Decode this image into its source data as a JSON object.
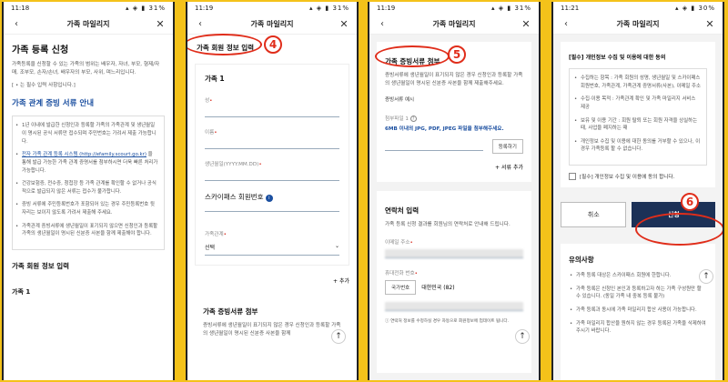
{
  "phones": [
    {
      "time": "11:18",
      "battery": "31%"
    },
    {
      "time": "11:19",
      "battery": "31%"
    },
    {
      "time": "11:19",
      "battery": "31%"
    },
    {
      "time": "11:21",
      "battery": "30%"
    }
  ],
  "nav_title": "가족 마일리지",
  "icons": {
    "back": "chevron-left-icon",
    "close": "close-icon",
    "info": "info-icon",
    "help": "help-icon",
    "up": "arrow-up-icon",
    "plus": "plus-icon",
    "down": "chevron-down-icon"
  },
  "s1": {
    "title": "가족 등록 신청",
    "desc": "가족등록을 신청할 수 있는 가족의 범위는 배우자, 자녀, 부모, 형제/자매, 조부모, 손자/손녀, 배우자의 부모, 사위, 며느리입니다.",
    "req": "[ • 는 필수 입력 사항입니다.]",
    "proof_title": "가족 관계 증빙 서류 안내",
    "b1": "1년 이내에 발급한 신청인과 등록할 가족의 가족관계 및 생년월일이 명시된 공식 서류만 접수되며 주민번호는 가려서 제출 가능합니다.",
    "b2_link": "전자 가족 관계 등록 시스템 (http://efamily.scourt.go.kr)",
    "b2_rest": "을 통해 발급 가능한 가족 관계 증명서를 첨부하시면 더욱 빠른 처리가 가능합니다.",
    "b3": "건강보험증, 전수증, 청첩장 등 가족 관계를 확인할 수 없거나 공식적으로 발급되지 않은 서류는 접수가 불가합니다.",
    "b4": "증빙 서류에 주민등록번호가 포함되어 있는 경우 주민등록번호 뒷자리는 보이지 않도록 가려서 제출해 주세요.",
    "b5": "가족관계 증빙서류에 생년월일이 표기되지 않으면 신청인과 등록할 가족의 생년월일이 명시된 신분증 사본을 함께 제출해야 합니다.",
    "input_title": "가족 회원 정보 입력",
    "fam1": "가족 1",
    "dot": "•"
  },
  "s2": {
    "header": "가족 회원 정보 입력",
    "fam1": "가족 1",
    "f_surname": "성",
    "f_name": "이름",
    "f_birth": "생년월일(YYYY.MM.DD)",
    "skypass": "스카이패스 회원번호",
    "relation_label": "가족관계",
    "relation_value": "선택",
    "add": "추가",
    "proof_title": "가족 증빙서류 첨부",
    "proof_desc": "증빙서류에 생년월일이 표기되지 않은 경우 신청인과 등록할 가족의 생년월일이 명시된 신분증 사본을 함께",
    "num": "4"
  },
  "s3": {
    "header": "가족 증빙서류 첨부",
    "desc": "증빙서류에 생년월일이 표기되지 않은 경우 신청인과 등록할 가족의 생년월일이 명시된 신분증 사본을 함께 제출해주세요.",
    "example": "증빙서류 예시",
    "attach_label": "첨부파일 1",
    "attach_note": "6MB 이내의 JPG, PDF, JPEG 파일을 첨부해주세요.",
    "register_btn": "등록하기",
    "add_doc": "서류 추가",
    "contact_title": "연락처 입력",
    "contact_desc": "가족 등록 신청 결과를 회원님의 연락처로 안내해 드립니다.",
    "email": "이메일 주소",
    "phone_label": "휴대전화 번호",
    "country_btn": "국가번호",
    "country_val": "대한민국 (82)",
    "footnote": "연락처 정보를 수정하실 경우 자동으로 회원정보에 업데이트 됩니다.",
    "num": "5"
  },
  "s4": {
    "consent_title": "[필수] 개인정보 수집 및 이용에 대한 동의",
    "c1": "수집하는 항목 : 가족 회원의 성명, 생년월일 및 스카이패스 회원번호, 가족관계, 가족관계 증명서류(사본), 이메일 주소",
    "c2": "수집·이용 목적 : 가족관계 확인 및 가족 마일리지 서비스 제공",
    "c3": "보유 및 이용 기간 : 회원 탈퇴 또는 회원 자격을 상실하는 때, 사업을 폐지하는 때",
    "c4": "개인정보 수집 및 이용에 대한 동의를 거부할 수 있으나, 이 경우 가족등록 할 수 없습니다.",
    "checkbox": "[필수] 개인정보 수집 및 이용에 동의 합니다.",
    "cancel": "취소",
    "submit": "신청",
    "notes_title": "유의사항",
    "n1": "가족 등록 대상은 스카이패스 회원에 한합니다.",
    "n2": "가족 등록은 신청인 본인과 등록하고자 하는 가족 구성원만 할 수 있습니다. (동일 가족 내 중복 등록 불가)",
    "n3": "가족 등록과 동시에 가족 마일리지 합산 사용이 가능합니다.",
    "n4": "가족 마일리지 합산을 원하지 않는 경우 등록된 가족을 삭제하여 주시기 바랍니다.",
    "num": "6"
  }
}
